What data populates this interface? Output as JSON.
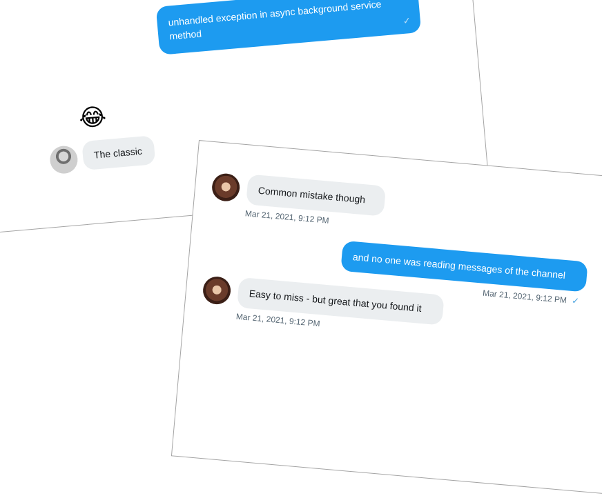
{
  "thread_top": {
    "outgoing_message": "unhandled exception in async background service method",
    "reaction_emoji": "😂",
    "incoming_message": "The classic"
  },
  "thread_bottom": {
    "messages": [
      {
        "text": "Common mistake though",
        "timestamp": "Mar 21, 2021, 9:12 PM"
      },
      {
        "text": "and no one was reading messages of the channel",
        "timestamp": "Mar 21, 2021, 9:12 PM"
      },
      {
        "text": "Easy to miss - but great that you found it",
        "timestamp": "Mar 21, 2021, 9:12 PM"
      }
    ]
  },
  "colors": {
    "outgoing_bubble": "#1d9bf0",
    "incoming_bubble": "#ebeef0",
    "read_check": "#4aa3df"
  },
  "icons": {
    "read_receipt": "check-icon"
  }
}
